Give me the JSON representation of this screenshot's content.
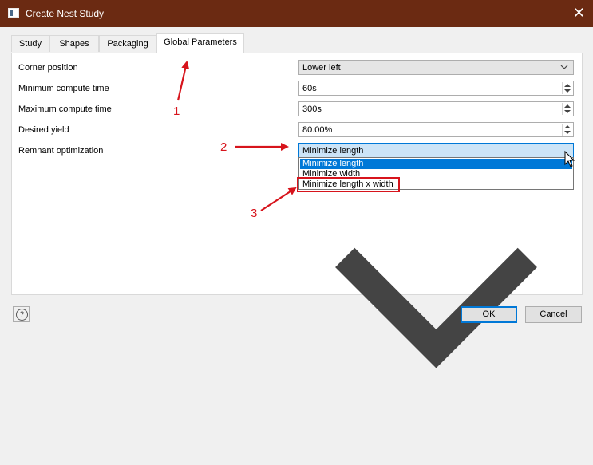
{
  "window": {
    "title": "Create Nest Study"
  },
  "tabs": [
    "Study",
    "Shapes",
    "Packaging",
    "Global Parameters"
  ],
  "params": [
    {
      "label": "Corner position",
      "value": "Lower left",
      "kind": "combo"
    },
    {
      "label": "Minimum compute time",
      "value": "60s",
      "kind": "spin"
    },
    {
      "label": "Maximum compute time",
      "value": "300s",
      "kind": "spin"
    },
    {
      "label": "Desired yield",
      "value": "80.00%",
      "kind": "spin"
    },
    {
      "label": "Remnant optimization",
      "value": "Minimize length",
      "kind": "combo-open"
    }
  ],
  "dropdown": {
    "options": [
      "Minimize length",
      "Minimize width",
      "Minimize length x width"
    ],
    "selected_index": 0
  },
  "buttons": {
    "ok": "OK",
    "cancel": "Cancel",
    "help": "?"
  },
  "annotations": {
    "a1": "1",
    "a2": "2",
    "a3": "3"
  },
  "colors": {
    "title_bar": "#6b2a12",
    "selection": "#0078d7",
    "annotation": "#d7141c"
  },
  "icons": [
    "app-window-icon",
    "close-icon",
    "chevron-down-icon",
    "spin-up-icon",
    "spin-down-icon",
    "help-icon",
    "mouse-cursor-icon"
  ]
}
